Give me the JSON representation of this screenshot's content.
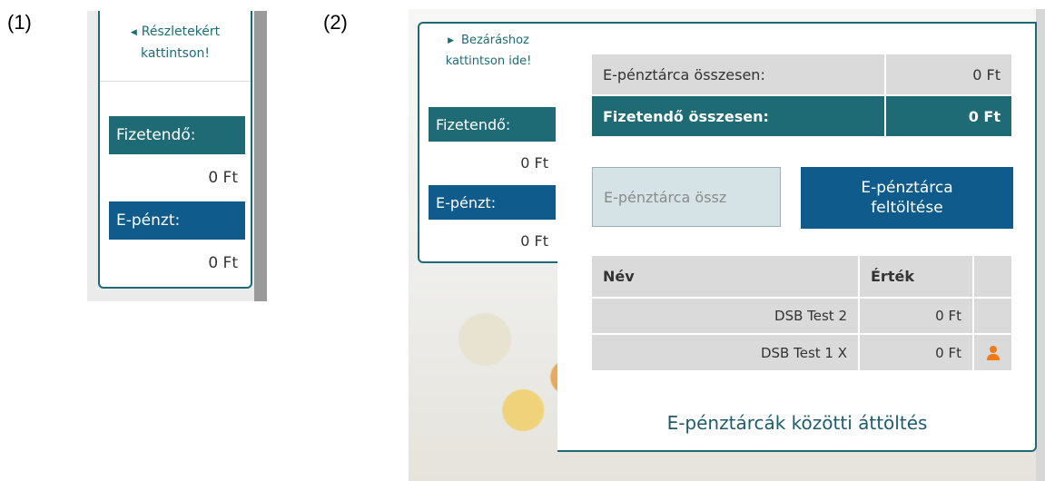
{
  "figure_labels": {
    "first": "(1)",
    "second": "(2)"
  },
  "panel1": {
    "toggle_line1": "Részletekért",
    "toggle_line2": "kattintson!",
    "fizetendo_label": "Fizetendő:",
    "fizetendo_value": "0 Ft",
    "epenzt_label": "E-pénzt:",
    "epenzt_value": "0 Ft"
  },
  "panel2": {
    "toggle_line1": "Bezáráshoz",
    "toggle_line2": "kattintson ide!",
    "fizetendo_label": "Fizetendő:",
    "fizetendo_value": "0 Ft",
    "epenzt_label": "E-pénzt:",
    "epenzt_value": "0 Ft",
    "summary": {
      "wallet_total_label": "E-pénztárca összesen:",
      "wallet_total_value": "0 Ft",
      "payable_total_label": "Fizetendő összesen:",
      "payable_total_value": "0 Ft"
    },
    "topup": {
      "input_placeholder": "E-pénztárca össz",
      "button_line1": "E-pénztárca",
      "button_line2": "feltöltése"
    },
    "table": {
      "headers": [
        "Név",
        "Érték",
        ""
      ],
      "rows": [
        {
          "name": "DSB Test 2",
          "value": "0 Ft",
          "icon": ""
        },
        {
          "name": "DSB Test 1 X",
          "value": "0 Ft",
          "icon": "person-icon"
        }
      ]
    },
    "transfer_link": "E-pénztárcák közötti áttöltés"
  },
  "colors": {
    "teal": "#1f6b75",
    "blue": "#0f5b8c",
    "grey_cell": "#dadada",
    "input_bg": "#d5e3e7",
    "person_icon": "#f07b16"
  }
}
